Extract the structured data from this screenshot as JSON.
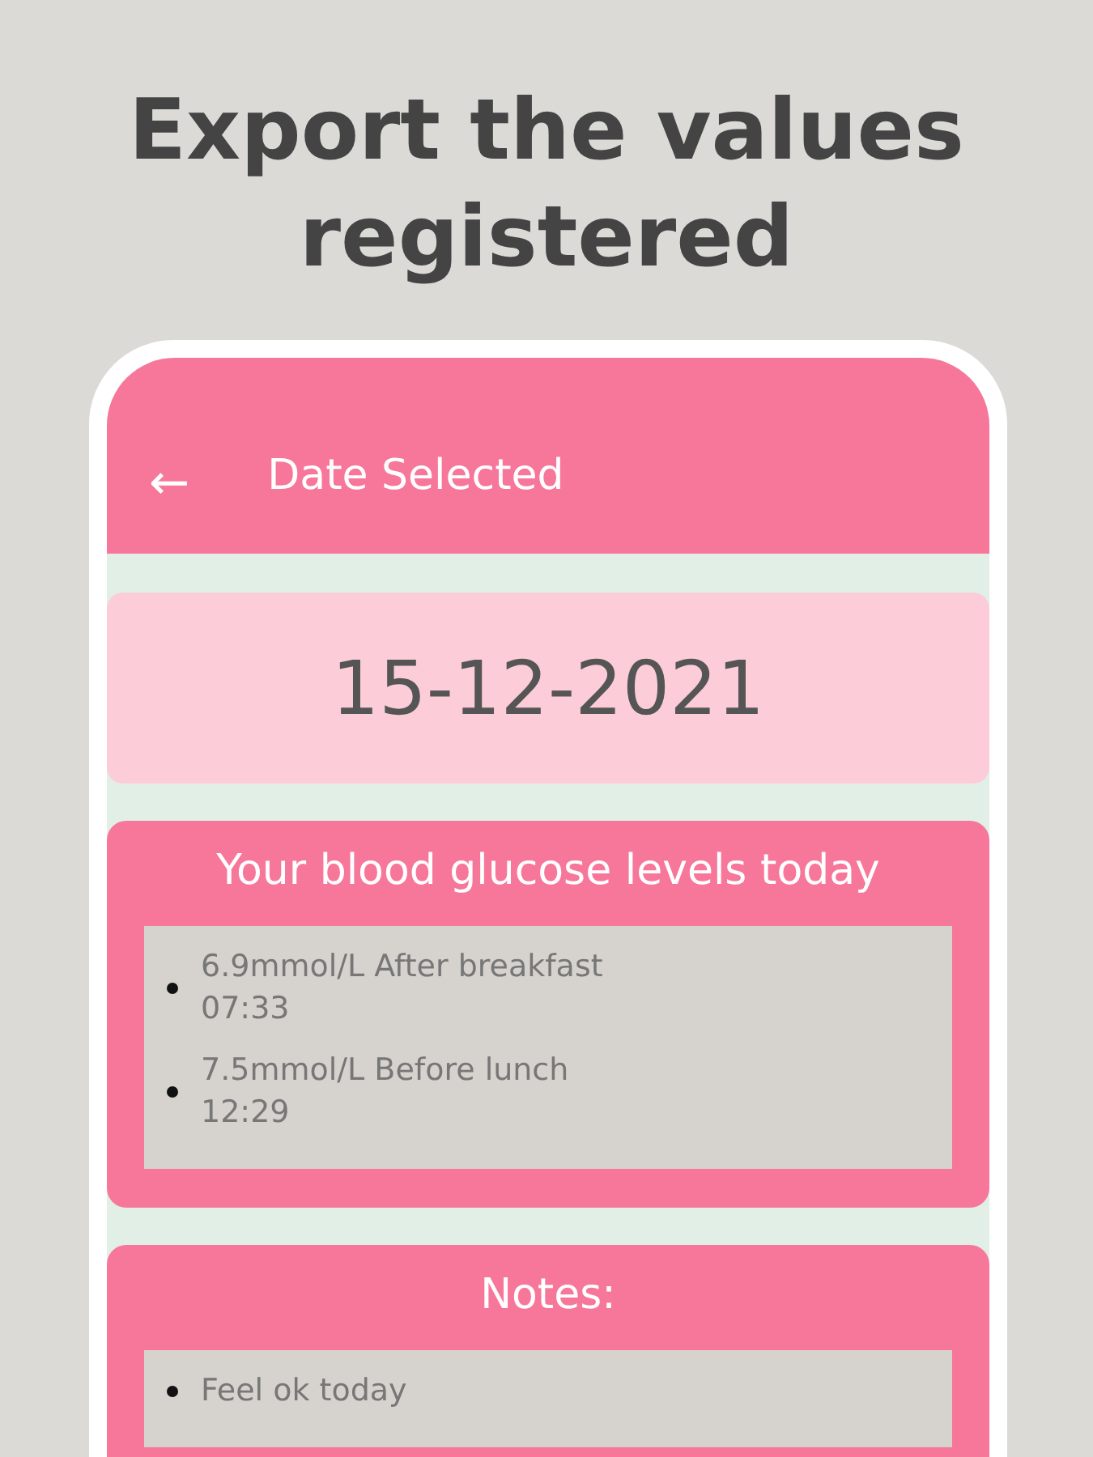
{
  "headline": "Export the values registered",
  "app_bar": {
    "back_icon": "←",
    "title": "Date Selected"
  },
  "date": "15-12-2021",
  "glucose": {
    "title": "Your blood glucose levels today",
    "entries": [
      {
        "reading": "6.9mmol/L After breakfast",
        "time": "07:33"
      },
      {
        "reading": "7.5mmol/L Before lunch",
        "time": "12:29"
      }
    ]
  },
  "notes": {
    "title": "Notes:",
    "items": [
      "Feel ok today"
    ]
  }
}
